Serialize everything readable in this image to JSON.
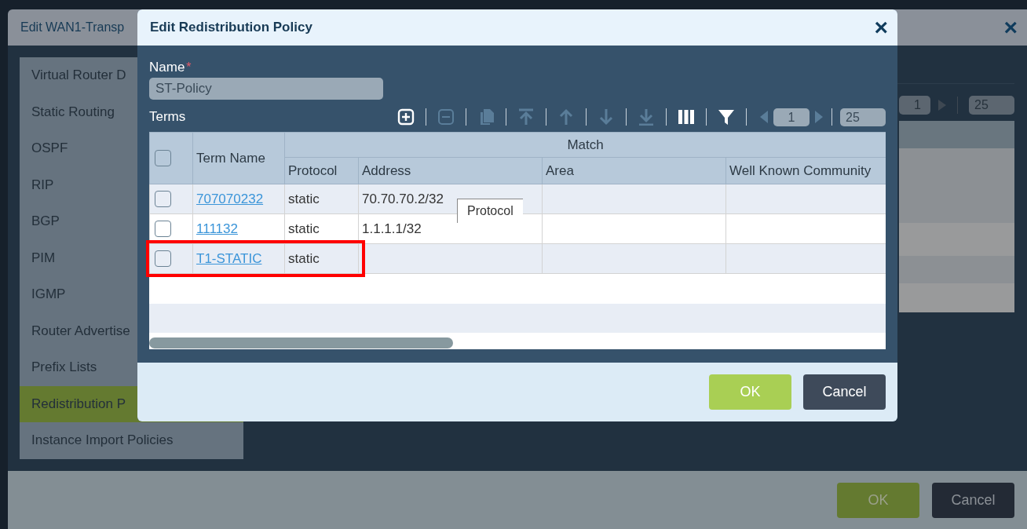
{
  "background_window": {
    "title": "Edit WAN1-Transp",
    "close": "×",
    "sidebar": {
      "items": [
        {
          "label": "Virtual Router D",
          "selected": false
        },
        {
          "label": "Static Routing",
          "selected": false
        },
        {
          "label": "OSPF",
          "selected": false
        },
        {
          "label": "RIP",
          "selected": false
        },
        {
          "label": "BGP",
          "selected": false
        },
        {
          "label": "PIM",
          "selected": false
        },
        {
          "label": "IGMP",
          "selected": false
        },
        {
          "label": "Router Advertise",
          "selected": false
        },
        {
          "label": "Prefix Lists",
          "selected": false
        },
        {
          "label": "Redistribution P",
          "selected": true
        },
        {
          "label": "Instance Import Policies",
          "selected": false
        }
      ]
    },
    "pagination": {
      "page": "1",
      "page_size": "25"
    },
    "buttons": [
      {
        "label": "OK",
        "kind": "primary"
      },
      {
        "label": "Cancel",
        "kind": "secondary"
      }
    ]
  },
  "dialog": {
    "title": "Edit Redistribution Policy",
    "close": "×",
    "name_label": "Name",
    "required_mark": "*",
    "name_value": "ST-Policy",
    "terms_label": "Terms",
    "toolbar": [
      {
        "kind": "add",
        "disabled": false
      },
      {
        "kind": "remove",
        "disabled": true
      },
      {
        "kind": "copy",
        "disabled": true
      },
      {
        "kind": "move-top",
        "disabled": true
      },
      {
        "kind": "move-up",
        "disabled": true
      },
      {
        "kind": "move-down",
        "disabled": true
      },
      {
        "kind": "move-bottom",
        "disabled": true
      },
      {
        "kind": "columns",
        "disabled": false
      },
      {
        "kind": "filter",
        "disabled": false
      }
    ],
    "pagination": {
      "page": "1",
      "page_size": "25"
    },
    "table": {
      "all_selected": false,
      "group_header": "Match",
      "columns": [
        "Term Name",
        "Protocol",
        "Address",
        "Area",
        "Well Known Community"
      ],
      "rows": [
        {
          "selected": false,
          "term_name": "707070232",
          "protocol": "static",
          "address": "70.70.70.2/32"
        },
        {
          "selected": false,
          "term_name": "111132",
          "protocol": "static",
          "address": "1.1.1.1/32"
        },
        {
          "selected": false,
          "term_name": "T1-STATIC",
          "protocol": "static"
        }
      ]
    },
    "tooltip": "Protocol",
    "buttons": [
      {
        "label": "OK",
        "kind": "primary"
      },
      {
        "label": "Cancel",
        "kind": "secondary"
      }
    ]
  }
}
